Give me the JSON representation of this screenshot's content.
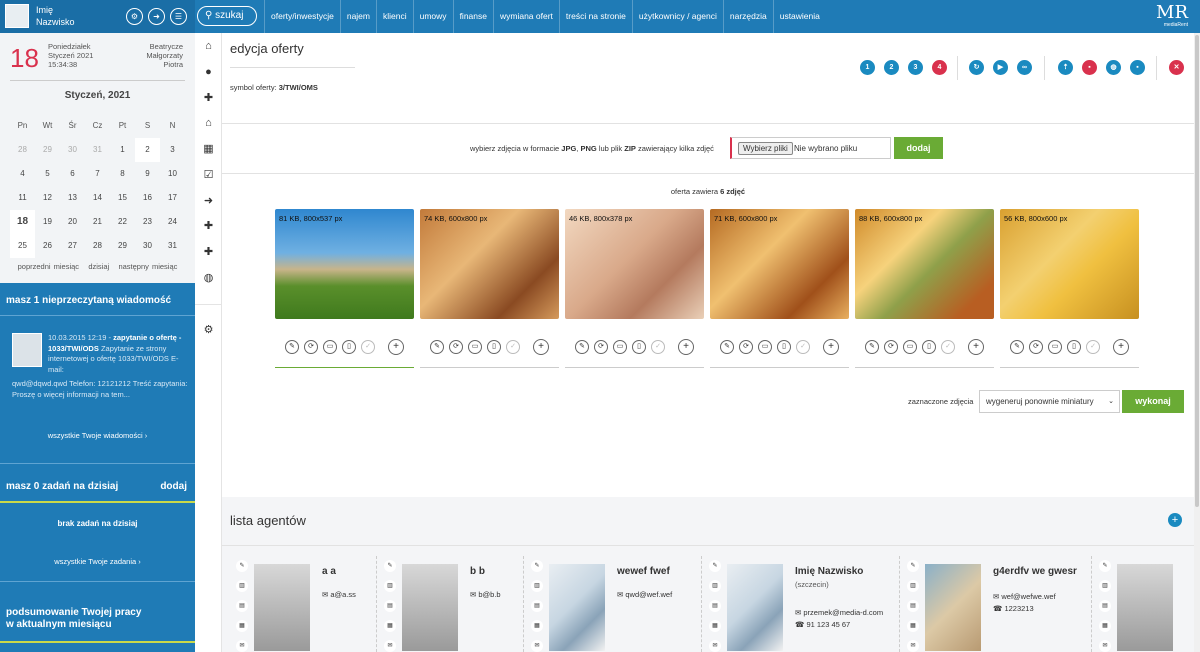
{
  "user": {
    "first_name": "Imię",
    "last_name": "Nazwisko"
  },
  "search": {
    "label": "szukaj"
  },
  "nav": [
    "oferty/inwestycje",
    "najem",
    "klienci",
    "umowy",
    "finanse",
    "wymiana ofert",
    "treści na stronie",
    "użytkownicy / agenci",
    "narzędzia",
    "ustawienia"
  ],
  "logo": {
    "text": "MR",
    "sub": "mediaRent"
  },
  "calendar": {
    "day_number": "18",
    "weekday": "Poniedziałek",
    "date": "Styczeń 2021",
    "time": "15:34:38",
    "namedays": [
      "Beatrycze",
      "Małgorzaty",
      "Piotra"
    ],
    "month_title": "Styczeń, 2021",
    "weekdays": [
      "Pn",
      "Wt",
      "Śr",
      "Cz",
      "Pt",
      "S",
      "N"
    ],
    "days": [
      "28",
      "29",
      "30",
      "31",
      "1",
      "2",
      "3",
      "4",
      "5",
      "6",
      "7",
      "8",
      "9",
      "10",
      "11",
      "12",
      "13",
      "14",
      "15",
      "16",
      "17",
      "18",
      "19",
      "20",
      "21",
      "22",
      "23",
      "24",
      "25",
      "26",
      "27",
      "28",
      "29",
      "30",
      "31"
    ],
    "prev": "poprzedni miesiąc",
    "today": "dzisiaj",
    "next": "następny miesiąc"
  },
  "messages": {
    "header_pre": "masz ",
    "count": "1",
    "header_post": " nieprzeczytaną wiadomość",
    "item_date": "10.03.2015 12:19 - ",
    "item_subject": "zapytanie o ofertę - 1033/TWI/ODS",
    "item_body": "Zapytanie ze strony internetowej o ofertę 1033/TWI/ODS E-mail:",
    "item_body2": "qwd@dqwd.qwd Telefon: 12121212 Treść zapytania: Proszę o więcej informacji na tem...",
    "all_link": "wszystkie Twoje wiadomości"
  },
  "tasks": {
    "header_pre": "masz ",
    "count": "0",
    "header_post": " zadań na dzisiaj",
    "add": "dodaj",
    "none": "brak zadań na dzisiaj",
    "all_link": "wszystkie Twoje zadania"
  },
  "summary": {
    "line1": "podsumowanie Twojej pracy",
    "line2": "w aktualnym miesiącu"
  },
  "page": {
    "title": "edycja oferty",
    "symbol_label": "symbol oferty: ",
    "symbol_value": "3/TWI/OMS",
    "steps": [
      "1",
      "2",
      "3",
      "4"
    ]
  },
  "upload": {
    "text_1": "wybierz zdjęcia w formacie ",
    "jpg": "JPG",
    "comma": ", ",
    "png": "PNG",
    "text_2": " lub plik ",
    "zip": "ZIP",
    "text_3": " zawierający kilka zdjęć",
    "file_button": "Wybierz pliki",
    "file_text": "Nie wybrano pliku",
    "add_button": "dodaj"
  },
  "photos": {
    "count_pre": "oferta zawiera ",
    "count": "6 zdjęć",
    "items": [
      {
        "label": "81 KB, 800x537 px"
      },
      {
        "label": "74 KB, 600x800 px"
      },
      {
        "label": "46 KB, 800x378 px"
      },
      {
        "label": "71 KB, 600x800 px"
      },
      {
        "label": "88 KB, 600x800 px"
      },
      {
        "label": "56 KB, 800x600 px"
      }
    ],
    "marked_label": "zaznaczone zdjęcia",
    "action_select": "wygeneruj ponownie miniatury",
    "execute": "wykonaj"
  },
  "agents": {
    "title": "lista agentów",
    "items": [
      {
        "name": "a a",
        "city": "",
        "email": "a@a.ss",
        "phone": ""
      },
      {
        "name": "b b",
        "city": "",
        "email": "b@b.b",
        "phone": ""
      },
      {
        "name": "wewef fwef",
        "city": "",
        "email": "qwd@wef.wef",
        "phone": ""
      },
      {
        "name": "Imię Nazwisko",
        "city": "(szczecin)",
        "email": "przemek@media-d.com",
        "phone": "91 123 45 67"
      },
      {
        "name": "g4erdfv we gwesr",
        "city": "",
        "email": "wef@wefwe.wef",
        "phone": "1223213"
      }
    ]
  },
  "colors": {
    "primary": "#1f7bb6",
    "accent_red": "#d9314d",
    "green": "#6aab35"
  }
}
